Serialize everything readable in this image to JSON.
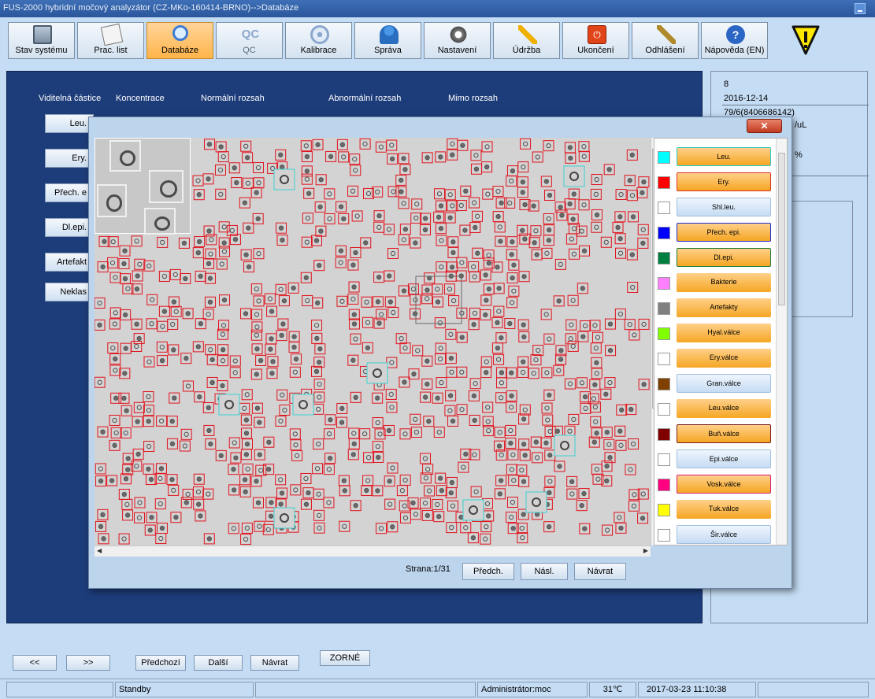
{
  "window": {
    "title": "FUS-2000 hybridní močový analyzátor (CZ-MKo-160414-BRNO)-->Databáze"
  },
  "toolbar": {
    "items": [
      {
        "label": "Stav systému",
        "icon": "monitor-icon"
      },
      {
        "label": "Prac. list",
        "icon": "clipboard-icon"
      },
      {
        "label": "Databáze",
        "icon": "search-icon",
        "active": true
      },
      {
        "label": "QC",
        "icon": "qc-icon",
        "disabled": true
      },
      {
        "label": "Kalibrace",
        "icon": "target-icon"
      },
      {
        "label": "Správa",
        "icon": "user-icon"
      },
      {
        "label": "Nastavení",
        "icon": "gear-icon"
      },
      {
        "label": "Údržba",
        "icon": "tools-icon"
      },
      {
        "label": "Ukončení",
        "icon": "power-icon"
      },
      {
        "label": "Odhlášení",
        "icon": "key-icon"
      },
      {
        "label": "Nápověda (EN)",
        "icon": "help-icon"
      }
    ],
    "qc_glyph": "QC",
    "power_glyph": "⏻",
    "help_glyph": "?"
  },
  "main": {
    "headers": {
      "particle": "Viditelná částice",
      "concentration": "Koncentrace",
      "normal": "Normální rozsah",
      "abnormal": "Abnormální rozsah",
      "out": "Mimo rozsah"
    },
    "side_buttons": [
      "Leu.",
      "Ery.",
      "Přech. e",
      "Dl.epi.",
      "Artefakt",
      "Neklas"
    ]
  },
  "right_panel": {
    "sample_no": "8",
    "date": "2016-12-14",
    "id": "79/6(8406686142)",
    "unit": "/uL",
    "percent": "%"
  },
  "popup": {
    "close_glyph": "✕",
    "page_label": "Strana:",
    "page_value": "1/31",
    "prev": "Předch.",
    "next": "Násl.",
    "back": "Návrat",
    "legend": [
      {
        "label": "Leu.",
        "color": "#00ffff",
        "style": "orange",
        "border": "#2ac8c8"
      },
      {
        "label": "Ery.",
        "color": "#ff0000",
        "style": "orange",
        "border": "#e03020"
      },
      {
        "label": "Shl.leu.",
        "color": "#ffffff",
        "style": "blue",
        "border": ""
      },
      {
        "label": "Přech. epi.",
        "color": "#0000ff",
        "style": "orange",
        "border": "#1c2ad0"
      },
      {
        "label": "Dl.epi.",
        "color": "#008040",
        "style": "orange",
        "border": "#1a7a3a"
      },
      {
        "label": "Bakterie",
        "color": "#ff80ff",
        "style": "orange",
        "border": ""
      },
      {
        "label": "Artefakty",
        "color": "#808080",
        "style": "orange",
        "border": ""
      },
      {
        "label": "Hyal.válce",
        "color": "#80ff00",
        "style": "orange",
        "border": ""
      },
      {
        "label": "Ery.válce",
        "color": "#ffffff",
        "style": "orange",
        "border": ""
      },
      {
        "label": "Gran.válce",
        "color": "#804000",
        "style": "blue",
        "border": ""
      },
      {
        "label": "Leu.válce",
        "color": "#ffffff",
        "style": "orange",
        "border": ""
      },
      {
        "label": "Buň.válce",
        "color": "#800000",
        "style": "orange",
        "border": "#7a1a1a"
      },
      {
        "label": "Epi.válce",
        "color": "#ffffff",
        "style": "blue",
        "border": ""
      },
      {
        "label": "Vosk.válce",
        "color": "#ff0080",
        "style": "orange",
        "border": "#d02070"
      },
      {
        "label": "Tuk.válce",
        "color": "#ffff00",
        "style": "orange",
        "border": ""
      },
      {
        "label": "Šir.válce",
        "color": "#ffffff",
        "style": "blue",
        "border": ""
      }
    ]
  },
  "bottom_nav": {
    "first": "<<",
    "last": ">>",
    "prev": "Předchozí",
    "next": "Další",
    "back": "Návrat",
    "zorne": "ZORNÉ"
  },
  "status": {
    "state": "Standby",
    "user": "Administrátor:moc",
    "temp": "31℃",
    "datetime": "2017-03-23 11:10:38"
  }
}
